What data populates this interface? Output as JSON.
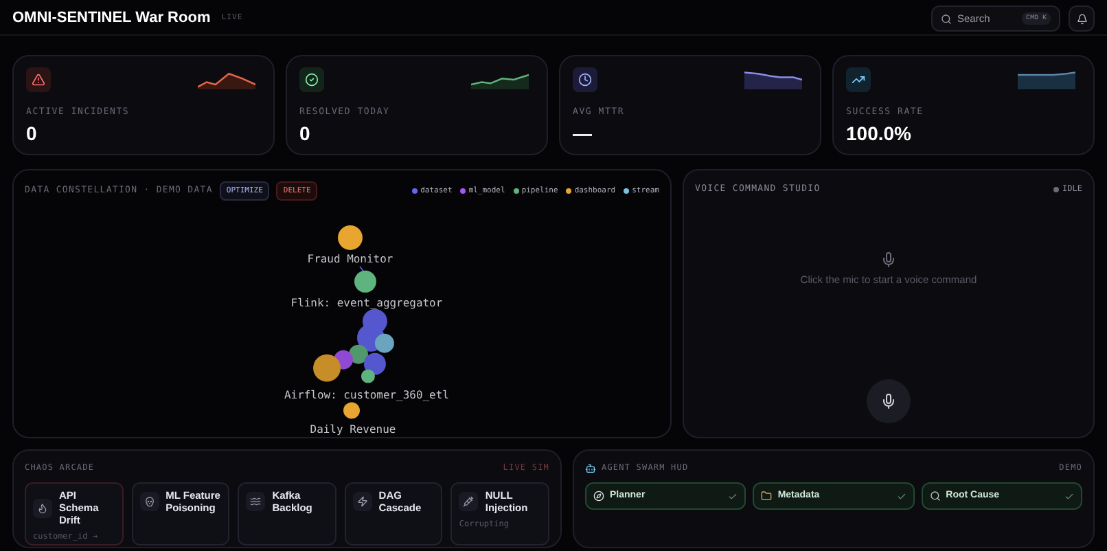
{
  "header": {
    "title": "OMNI-SENTINEL War Room",
    "badge": "LIVE",
    "search": {
      "placeholder": "Search",
      "shortcut": "CMD K"
    }
  },
  "stats": [
    {
      "kind": "alert",
      "label": "ACTIVE INCIDENTS",
      "value": "0"
    },
    {
      "kind": "resolved",
      "label": "RESOLVED TODAY",
      "value": "0"
    },
    {
      "kind": "time",
      "label": "AVG MTTR",
      "value": "—"
    },
    {
      "kind": "trend",
      "label": "SUCCESS RATE",
      "value": "100.0%"
    }
  ],
  "constellation": {
    "title": "DATA CONSTELLATION · DEMO DATA",
    "actions": [
      {
        "kind": "optimize",
        "label": "OPTIMIZE"
      },
      {
        "kind": "delete",
        "label": "DELETE"
      }
    ],
    "legend": [
      {
        "label": "dataset",
        "color": "#6366f1"
      },
      {
        "label": "ml_model",
        "color": "#a855f7"
      },
      {
        "label": "pipeline",
        "color": "#5fb37e"
      },
      {
        "label": "dashboard",
        "color": "#e8a530"
      },
      {
        "label": "stream",
        "color": "#7cc0e0"
      }
    ],
    "nodes": [
      {
        "label": "Fraud Monitor",
        "color": "#e8a530"
      },
      {
        "label": "Flink: event_aggregator",
        "color": "#5fb37e"
      },
      {
        "label": "Airflow: customer_360_etl",
        "color": "#5fb37e"
      },
      {
        "label": "Daily Revenue",
        "color": "#e8a530"
      }
    ]
  },
  "voice": {
    "title": "VOICE COMMAND STUDIO",
    "status": "IDLE",
    "hint": "Click the mic to start a voice command"
  },
  "chaos": {
    "title": "CHAOS ARCADE",
    "badge": "LIVE SIM",
    "cards": [
      {
        "kind": "flame",
        "title": "API Schema Drift",
        "detail": "customer_id →"
      },
      {
        "kind": "skull",
        "title": "ML Feature Poisoning"
      },
      {
        "kind": "waves",
        "title": "Kafka Backlog"
      },
      {
        "kind": "zap",
        "title": "DAG Cascade"
      },
      {
        "kind": "syringe",
        "title": "NULL Injection",
        "detail": "Corrupting"
      }
    ]
  },
  "swarm": {
    "title": "AGENT SWARM HUD",
    "badge": "DEMO",
    "agents": [
      {
        "kind": "planner",
        "name": "Planner",
        "done": true
      },
      {
        "kind": "metadata",
        "name": "Metadata",
        "done": true
      },
      {
        "kind": "search",
        "name": "Root Cause",
        "done": true
      }
    ]
  }
}
